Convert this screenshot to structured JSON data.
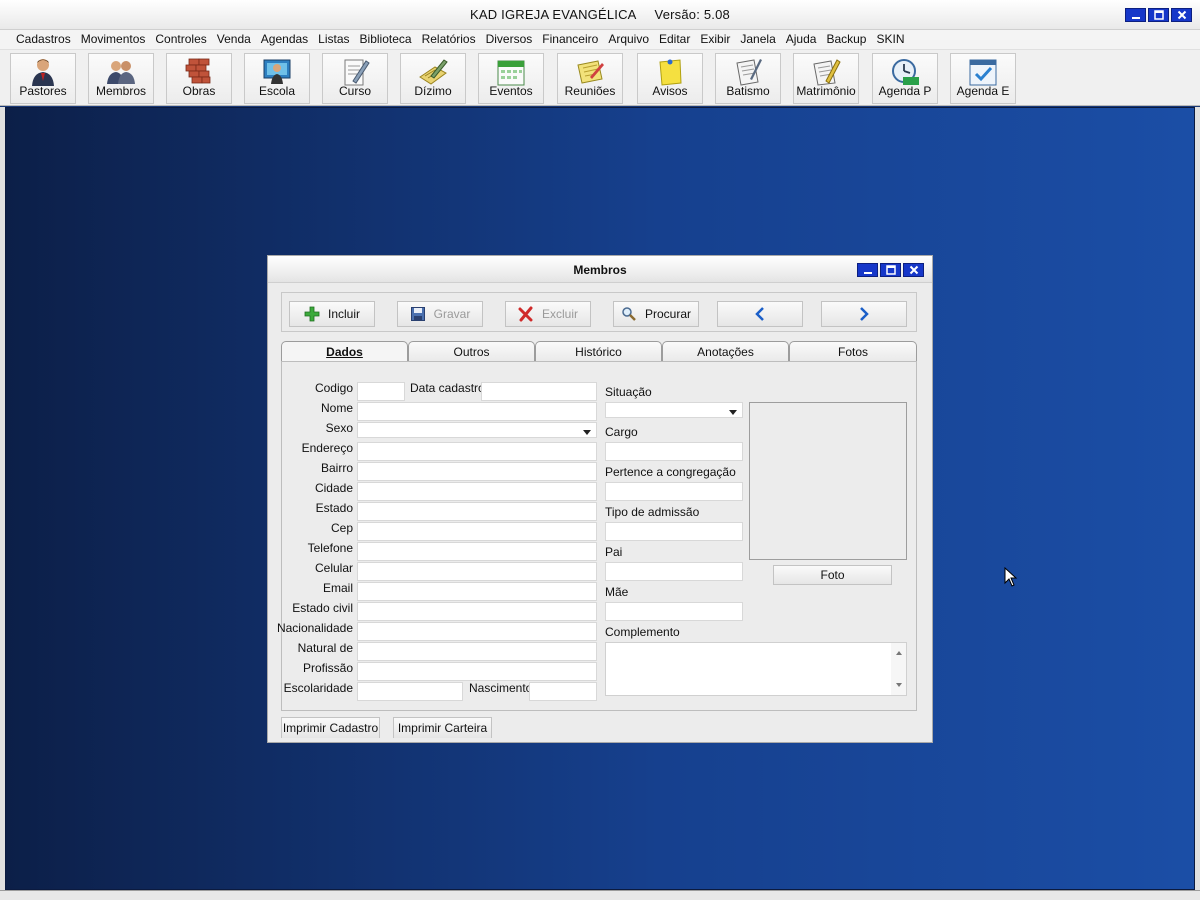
{
  "app": {
    "title": "KAD IGREJA EVANGÉLICA",
    "version": "Versão: 5.08"
  },
  "menu": [
    "Cadastros",
    "Movimentos",
    "Controles",
    "Venda",
    "Agendas",
    "Listas",
    "Biblioteca",
    "Relatórios",
    "Diversos",
    "Financeiro",
    "Arquivo",
    "Editar",
    "Exibir",
    "Janela",
    "Ajuda",
    "Backup",
    "SKIN"
  ],
  "toolbar": [
    {
      "label": "Pastores",
      "icon": "pastor-icon"
    },
    {
      "label": "Membros",
      "icon": "members-icon"
    },
    {
      "label": "Obras",
      "icon": "bricks-icon"
    },
    {
      "label": "Escola",
      "icon": "school-icon"
    },
    {
      "label": "Curso",
      "icon": "course-icon"
    },
    {
      "label": "Dízimo",
      "icon": "tithe-icon"
    },
    {
      "label": "Eventos",
      "icon": "calendar-icon"
    },
    {
      "label": "Reuniões",
      "icon": "meeting-icon"
    },
    {
      "label": "Avisos",
      "icon": "note-icon"
    },
    {
      "label": "Batismo",
      "icon": "baptism-icon"
    },
    {
      "label": "Matrimônio",
      "icon": "marriage-icon"
    },
    {
      "label": "Agenda P",
      "icon": "clock-icon"
    },
    {
      "label": "Agenda E",
      "icon": "checkbox-calendar-icon"
    }
  ],
  "dialog": {
    "title": "Membros",
    "commands": {
      "incluir": "Incluir",
      "gravar": "Gravar",
      "excluir": "Excluir",
      "procurar": "Procurar"
    },
    "tabs": [
      "Dados",
      "Outros",
      "Histórico",
      "Anotações",
      "Fotos"
    ],
    "left_labels": {
      "codigo": "Codigo",
      "data_cadastro": "Data cadastro",
      "nome": "Nome",
      "sexo": "Sexo",
      "endereco": "Endereço",
      "bairro": "Bairro",
      "cidade": "Cidade",
      "estado": "Estado",
      "cep": "Cep",
      "telefone": "Telefone",
      "celular": "Celular",
      "email": "Email",
      "estado_civil": "Estado civil",
      "nacionalidade": "Nacionalidade",
      "natural_de": "Natural de",
      "profissao": "Profissão",
      "escolaridade": "Escolaridade",
      "nascimento": "Nascimento"
    },
    "right_labels": {
      "situacao": "Situação",
      "cargo": "Cargo",
      "congregacao": "Pertence a congregação",
      "tipo_admissao": "Tipo de admissão",
      "pai": "Pai",
      "mae": "Mãe",
      "complemento": "Complemento"
    },
    "foto_button": "Foto",
    "print_cadastro": "Imprimir Cadastro",
    "print_carteira": "Imprimir Carteira"
  }
}
